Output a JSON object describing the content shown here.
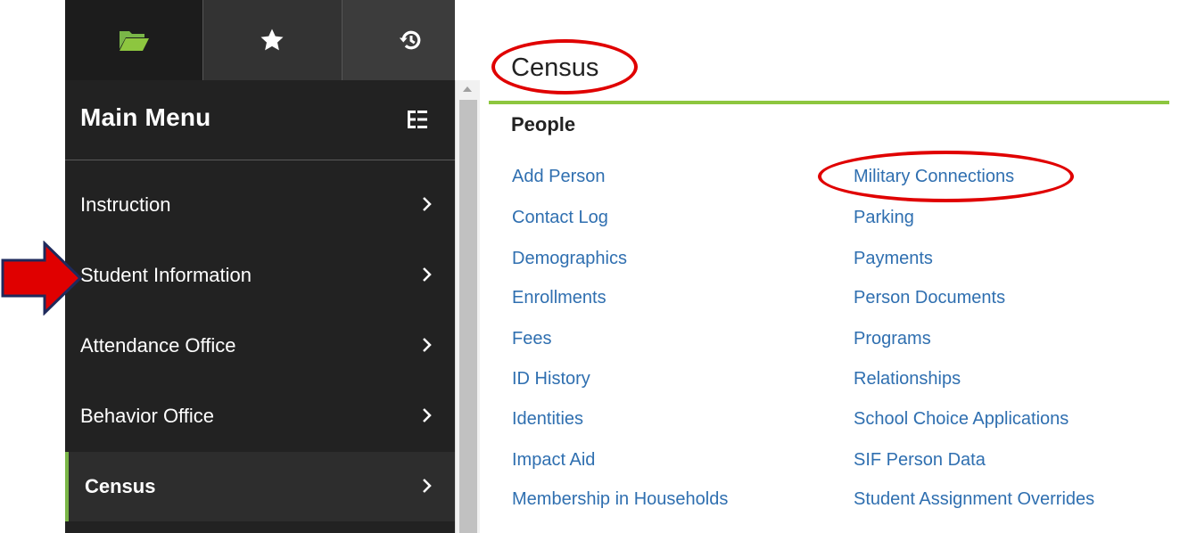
{
  "sidebar": {
    "tabs": [
      {
        "icon": "folder-open-icon"
      },
      {
        "icon": "star-icon"
      },
      {
        "icon": "history-icon"
      }
    ],
    "title": "Main Menu",
    "items": [
      {
        "label": "Instruction"
      },
      {
        "label": "Student Information"
      },
      {
        "label": "Attendance Office"
      },
      {
        "label": "Behavior Office"
      },
      {
        "label": "Census",
        "active": true
      }
    ]
  },
  "main": {
    "title": "Census",
    "section": "People",
    "links_col1": [
      "Add Person",
      "Contact Log",
      "Demographics",
      "Enrollments",
      "Fees",
      "ID History",
      "Identities",
      "Impact Aid",
      "Membership in Households"
    ],
    "links_col2": [
      "Military Connections",
      "Parking",
      "Payments",
      "Person Documents",
      "Programs",
      "Relationships",
      "School Choice Applications",
      "SIF Person Data",
      "Student Assignment Overrides"
    ]
  },
  "colors": {
    "accent_green": "#8dc63f",
    "link_blue": "#2f6fb0",
    "annotation_red": "#e00000",
    "sidebar_bg": "#222222"
  }
}
